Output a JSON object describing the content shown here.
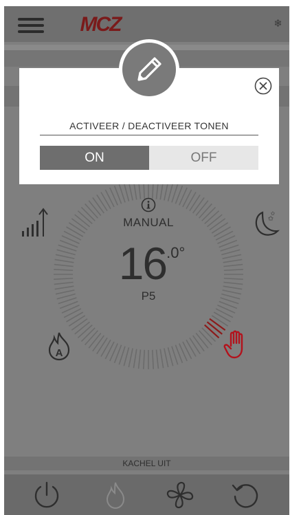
{
  "header": {
    "logo_text": "MCZ",
    "menu_icon": "hamburger-menu-icon",
    "status_icon": "snowflake-icon"
  },
  "main": {
    "mode_label": "MANUAL",
    "temperature_whole": "16",
    "temperature_decimal": ".0°",
    "power_label": "P5",
    "left_icons": [
      "power-level-icon",
      "auto-flame-icon"
    ],
    "right_icons": [
      "night-mode-icon",
      "manual-hand-icon"
    ]
  },
  "status_text": "KACHEL UIT",
  "bottom_nav": [
    "power-icon",
    "flame-icon",
    "fan-icon",
    "reset-icon"
  ],
  "modal": {
    "title": "ACTIVEER / DEACTIVEER TONEN",
    "on_label": "ON",
    "off_label": "OFF",
    "selected": "ON"
  },
  "colors": {
    "brand_red": "#b3121c",
    "overlay_gray": "#7f7f7f",
    "toggle_active": "#6e6e6e",
    "toggle_inactive": "#e7e7e7"
  }
}
